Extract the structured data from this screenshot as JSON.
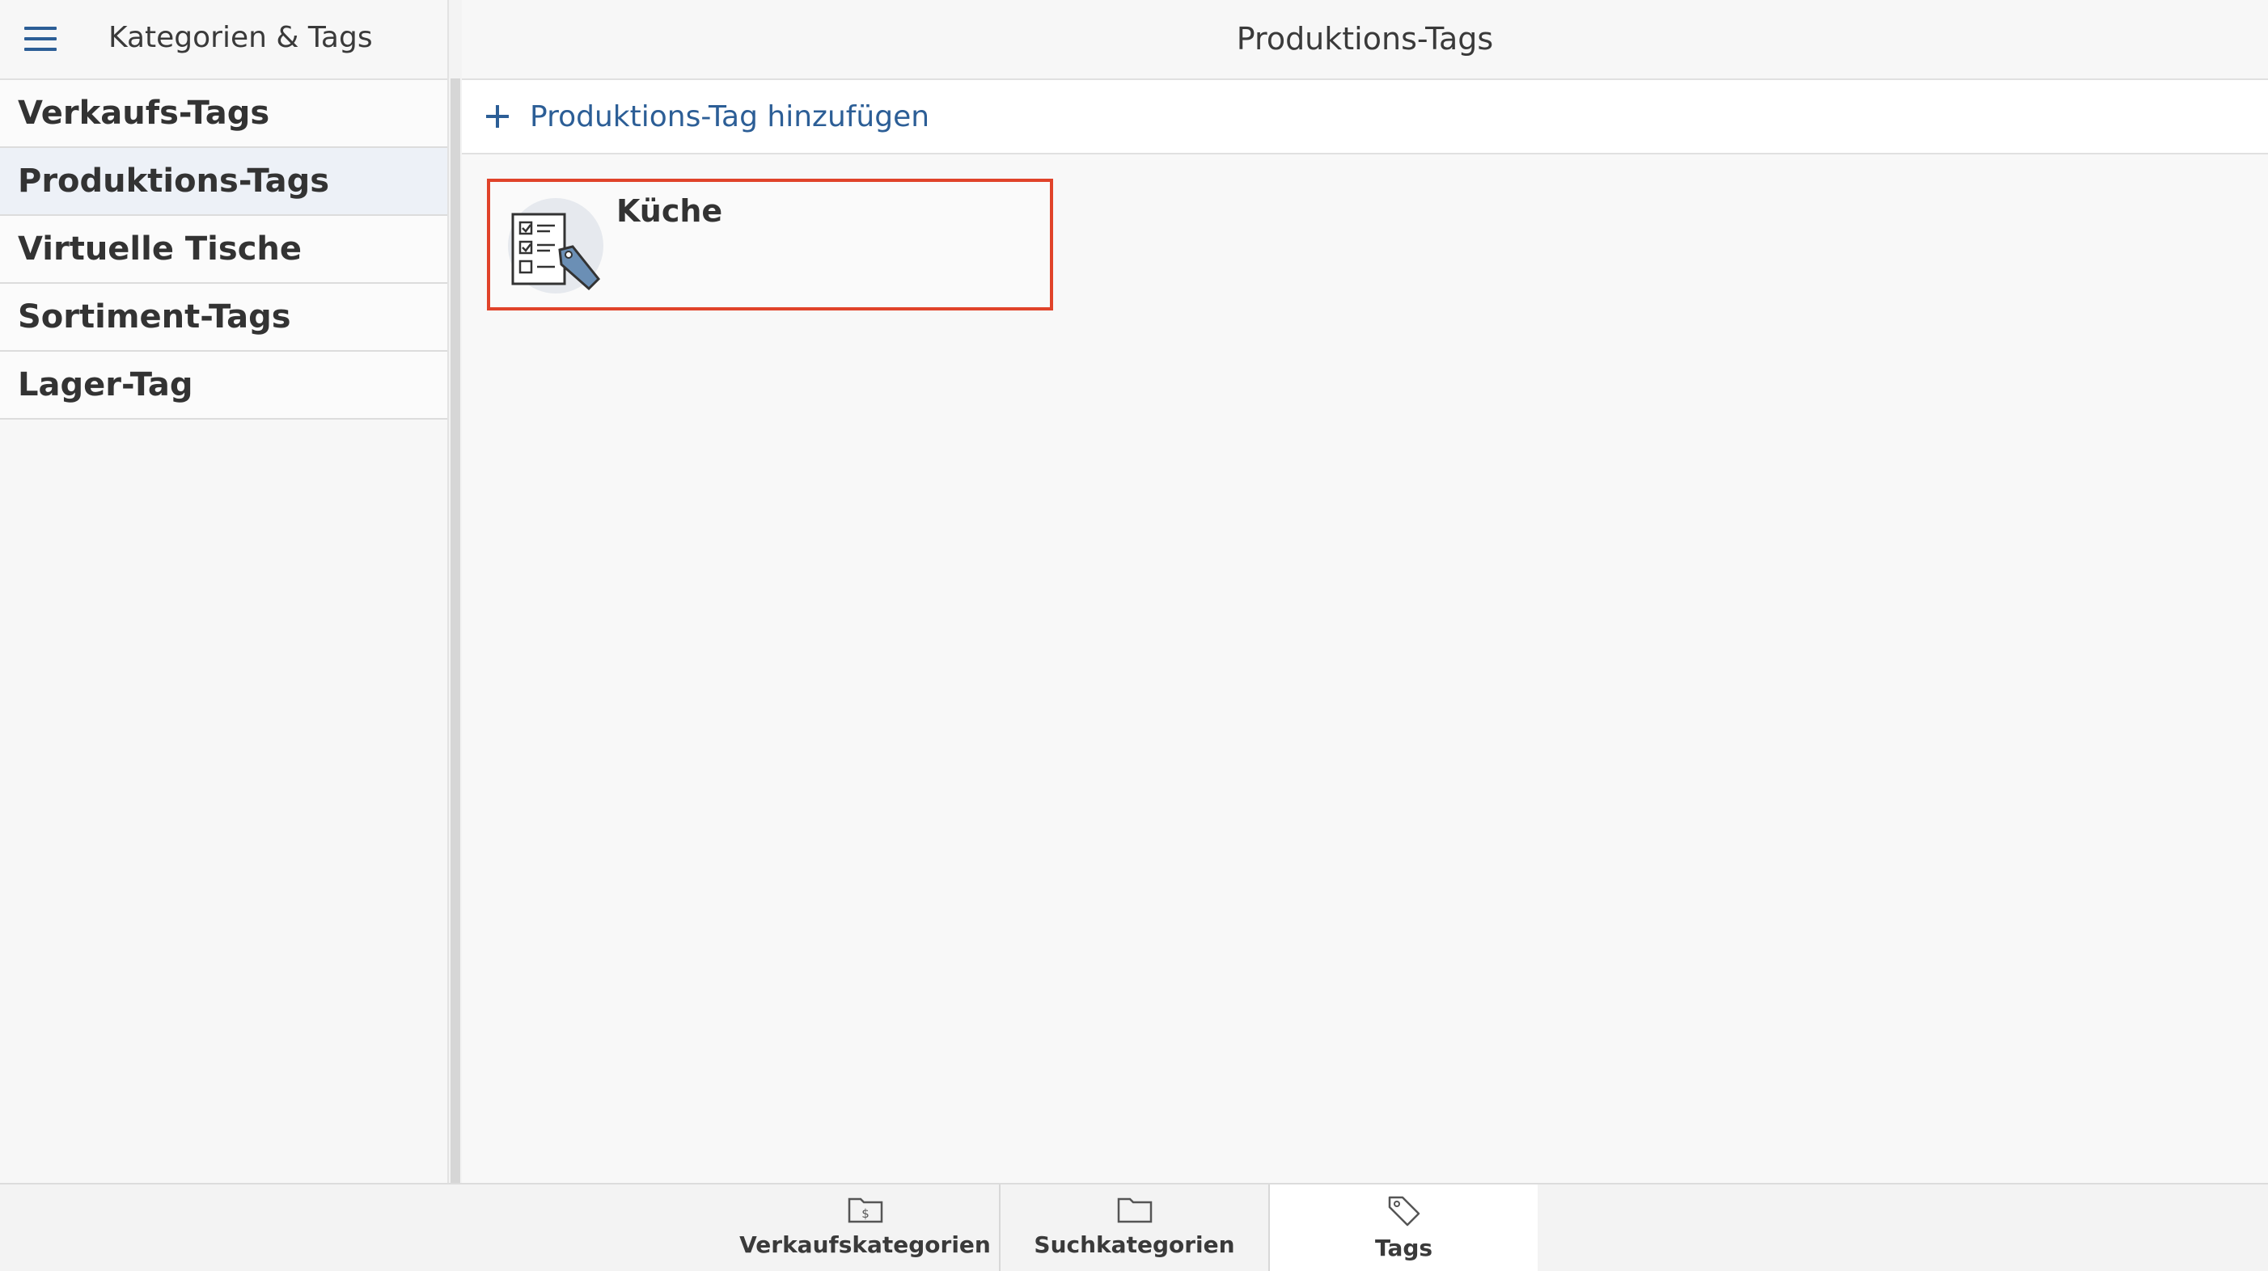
{
  "sidebar": {
    "title": "Kategorien & Tags",
    "items": [
      {
        "label": "Verkaufs-Tags"
      },
      {
        "label": "Produktions-Tags"
      },
      {
        "label": "Virtuelle Tische"
      },
      {
        "label": "Sortiment-Tags"
      },
      {
        "label": "Lager-Tag"
      }
    ],
    "active_index": 1
  },
  "main": {
    "title": "Produktions-Tags",
    "add_label": "Produktions-Tag hinzufügen",
    "tags": [
      {
        "label": "Küche",
        "icon": "production-tag-checklist-icon"
      }
    ]
  },
  "tabbar": {
    "tabs": [
      {
        "label": "Verkaufskategorien",
        "icon": "folder-dollar-icon"
      },
      {
        "label": "Suchkategorien",
        "icon": "folder-icon"
      },
      {
        "label": "Tags",
        "icon": "tag-icon"
      }
    ],
    "active_index": 2
  },
  "colors": {
    "accent": "#2c5e96",
    "selection_border": "#e0432a",
    "active_nav_bg": "#edf1f7"
  }
}
